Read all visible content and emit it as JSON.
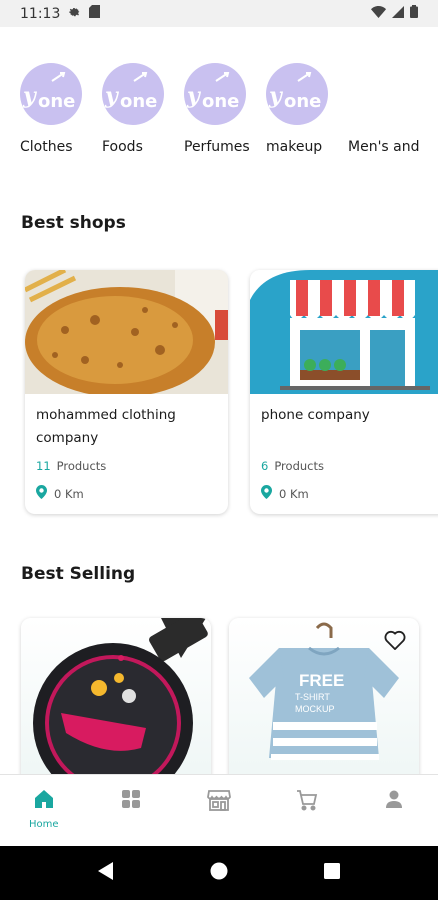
{
  "status_bar": {
    "time": "11:13"
  },
  "categories": [
    {
      "label": "Clothes"
    },
    {
      "label": "Foods"
    },
    {
      "label": "Perfumes"
    },
    {
      "label": "makeup"
    },
    {
      "label": "Men's and"
    }
  ],
  "category_logo_text": "one",
  "best_shops": {
    "title": "Best shops",
    "items": [
      {
        "name": "mohammed clothing company",
        "product_count": "11",
        "product_label": "Products",
        "distance": "0 Km"
      },
      {
        "name": "phone company",
        "product_count": "6",
        "product_label": "Products",
        "distance": "0 Km"
      }
    ]
  },
  "best_selling": {
    "title": "Best Selling"
  },
  "bottom_nav": {
    "items": [
      {
        "label": "Home",
        "icon": "home-icon",
        "active": true
      },
      {
        "label": "",
        "icon": "grid-icon",
        "active": false
      },
      {
        "label": "",
        "icon": "store-icon",
        "active": false
      },
      {
        "label": "",
        "icon": "cart-icon",
        "active": false
      },
      {
        "label": "",
        "icon": "person-icon",
        "active": false
      }
    ]
  },
  "colors": {
    "accent": "#1aa7a0",
    "category_circle": "#c9c1f0",
    "store_bg": "#2aa3c9"
  }
}
